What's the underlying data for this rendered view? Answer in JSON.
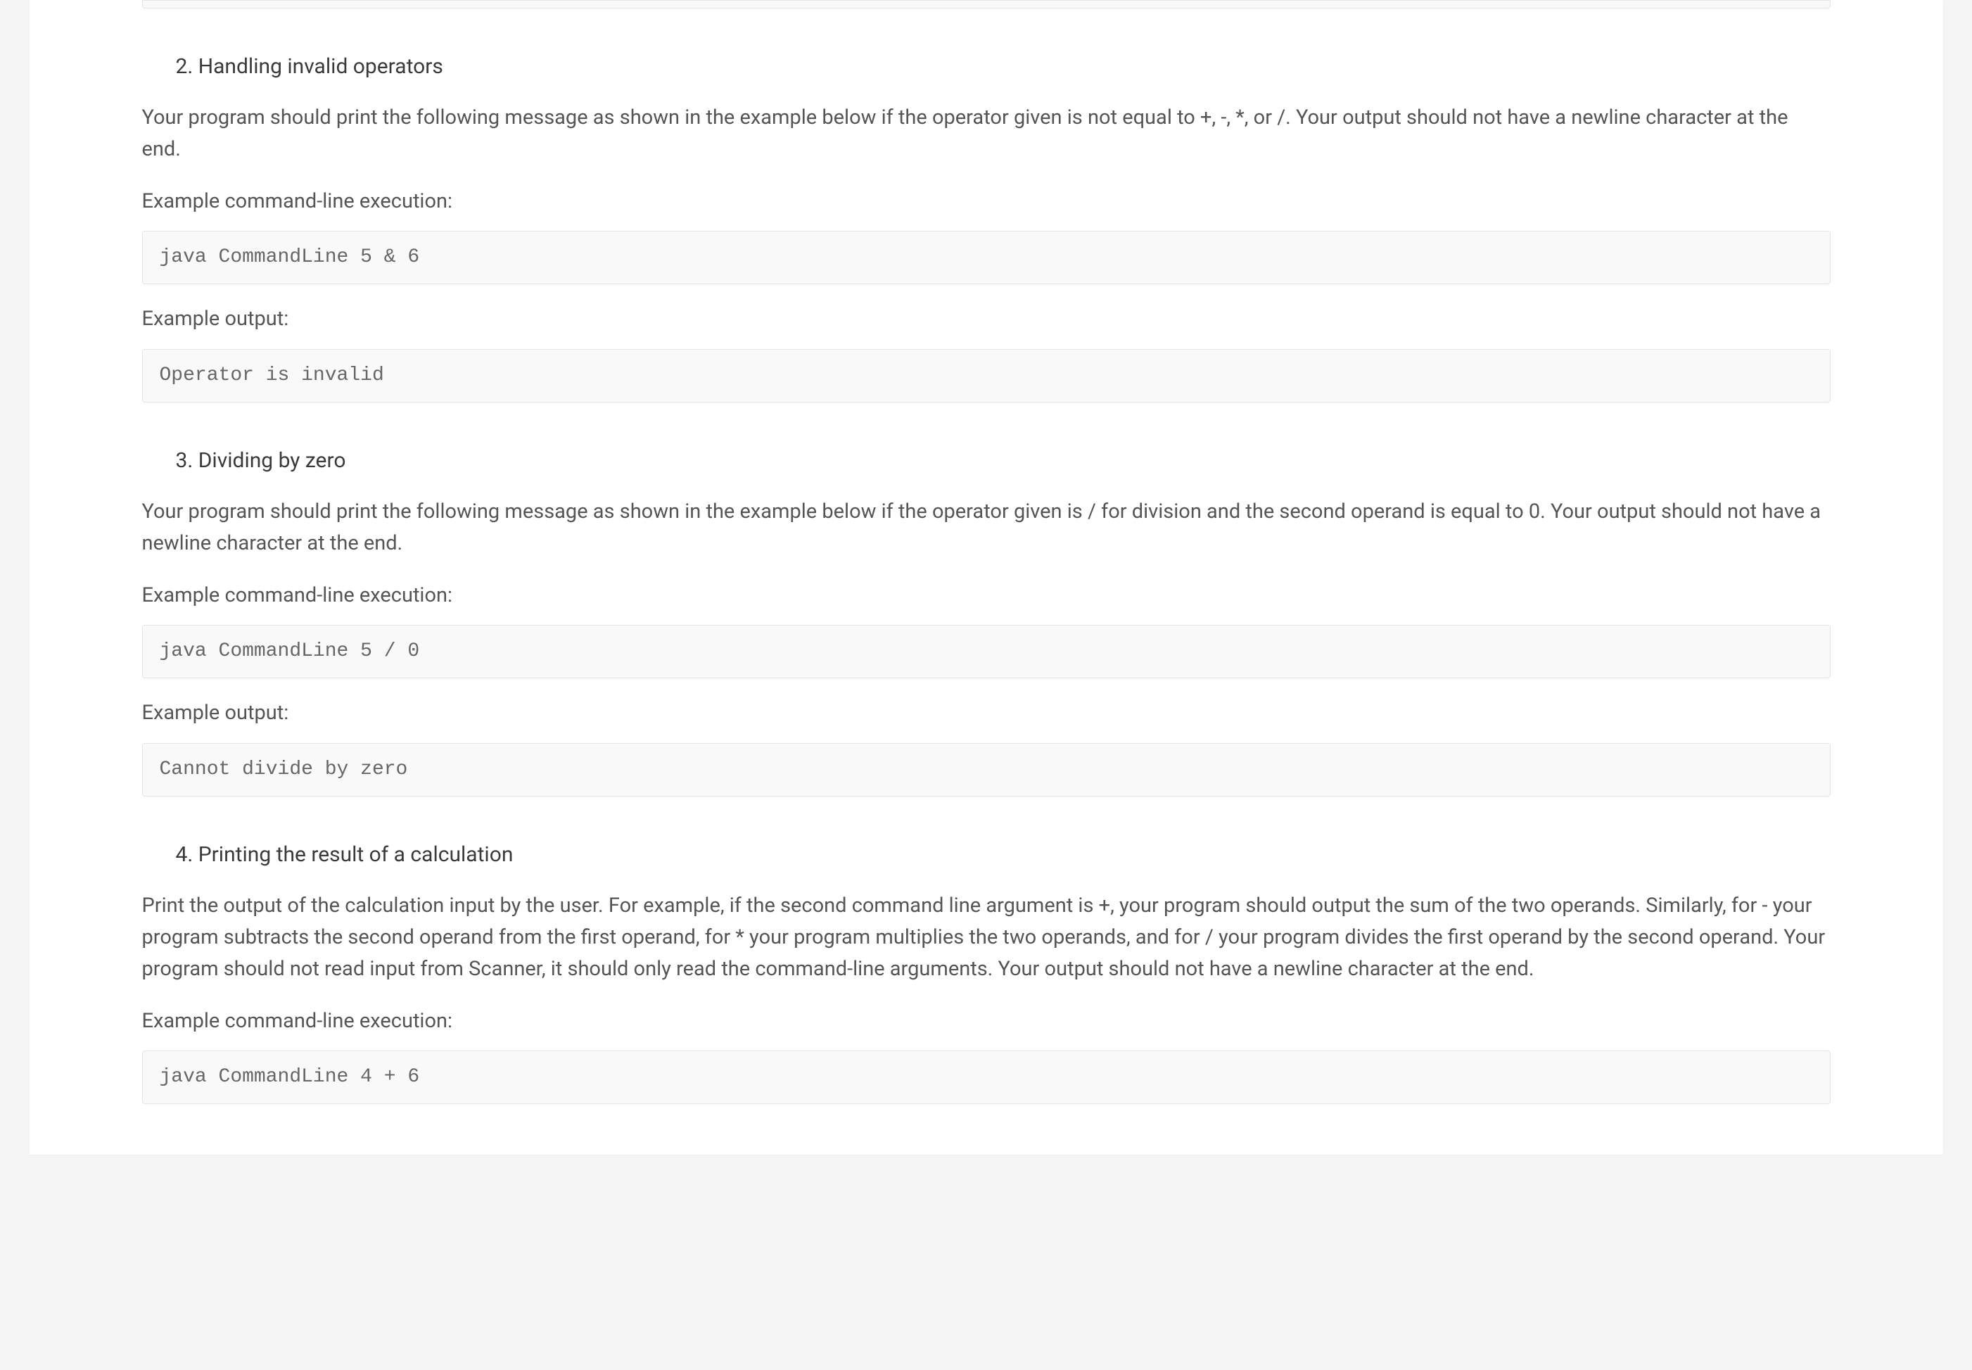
{
  "sections": [
    {
      "heading": "2. Handling invalid operators",
      "body": "Your program should print the following message as shown in the example below if the operator given is not equal to +, -, *, or /. Your output should not have a newline character at the end.",
      "exec_label": "Example command-line execution:",
      "exec_code": "java CommandLine 5 & 6",
      "output_label": "Example output:",
      "output_code": "Operator is invalid"
    },
    {
      "heading": "3. Dividing by zero",
      "body": "Your program should print the following message as shown in the example below if the operator given is / for division and the second operand is equal to 0. Your output should not have a newline character at the end.",
      "exec_label": "Example command-line execution:",
      "exec_code": "java CommandLine 5 / 0",
      "output_label": "Example output:",
      "output_code": "Cannot divide by zero"
    },
    {
      "heading": "4. Printing the result of a calculation",
      "body": "Print the output of the calculation input by the user. For example, if the second command line argument is +, your program should output the sum of the two operands. Similarly, for - your program subtracts the second operand from the first operand, for * your program multiplies the two operands, and for / your program divides the first operand by the second operand. Your program should not read input from Scanner, it should only read the command-line arguments. Your output should not have a newline character at the end.",
      "exec_label": "Example command-line execution:",
      "exec_code": "java CommandLine 4 + 6",
      "output_label": null,
      "output_code": null
    }
  ]
}
